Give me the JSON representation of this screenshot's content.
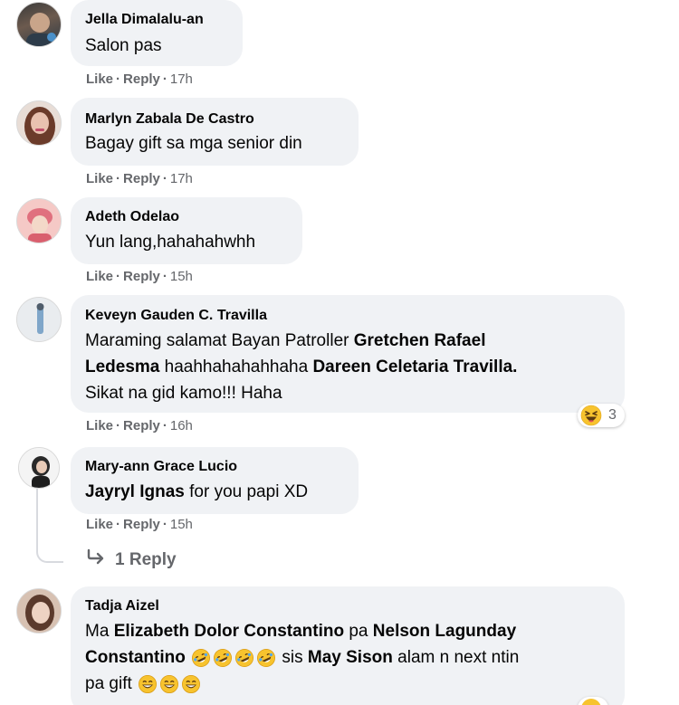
{
  "comments": [
    {
      "author": "Jella Dimalalu-an",
      "text": "Salon pas",
      "like": "Like",
      "reply": "Reply",
      "time": "17h"
    },
    {
      "author": "Marlyn Zabala De Castro",
      "text": "Bagay gift sa mga senior din",
      "like": "Like",
      "reply": "Reply",
      "time": "17h"
    },
    {
      "author": "Adeth Odelao",
      "text": "Yun lang,hahahahwhh",
      "like": "Like",
      "reply": "Reply",
      "time": "15h"
    },
    {
      "author": "Keveyn Gauden C. Travilla",
      "line1_prefix": "Maraming salamat Bayan Patroller ",
      "line1_mention": "Gretchen Rafael",
      "line2_mention1": "Ledesma",
      "line2_mid": " haahhahahahhaha ",
      "line2_mention2": "Dareen Celetaria Travilla.",
      "line3": "Sikat na gid kamo!!! Haha",
      "like": "Like",
      "reply": "Reply",
      "time": "16h",
      "reaction_icon": "haha-reaction-icon",
      "reaction_count": "3"
    },
    {
      "author": "Mary-ann Grace Lucio",
      "mention": "Jayryl Ignas",
      "text": " for you papi XD",
      "like": "Like",
      "reply": "Reply",
      "time": "15h",
      "replies_label": "1 Reply"
    },
    {
      "author": "Tadja Aizel",
      "line1_prefix": "Ma ",
      "line1_mention1": "Elizabeth Dolor Constantino",
      "line1_mid": " pa ",
      "line1_mention2": "Nelson Lagunday",
      "line2_mention": "Constantino",
      "line2_mid": " sis ",
      "line2_mention2": "May Sison",
      "line2_suffix": " alam n next ntin",
      "line3": "pa gift"
    }
  ],
  "colors": {
    "bubble": "#f0f2f5",
    "meta": "#65676b",
    "text": "#050505",
    "emoji_yellow": "#f7c32e"
  }
}
